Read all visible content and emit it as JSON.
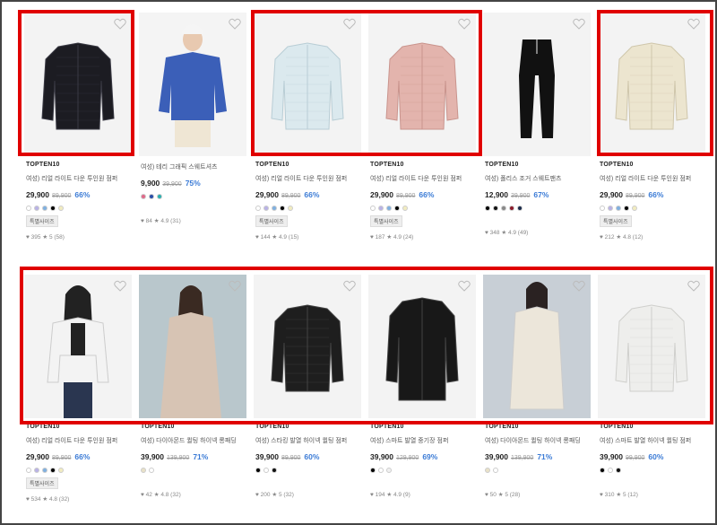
{
  "colors": {
    "highlight": "#e00000",
    "discount": "#3b7bd6"
  },
  "row1": [
    {
      "brand": "TOPTEN10",
      "name": "여성) 리얼 라이트 다운 투인원 점퍼",
      "price": "29,900",
      "orig": "89,900",
      "disc": "66%",
      "swatches": [
        "#ffffff",
        "#b9b2e6",
        "#7fb0e0",
        "#000000",
        "#f2ecc0"
      ],
      "badge": "특별사이즈",
      "stats": "♥ 395  ★ 5 (58)",
      "image": "black-quilted-jacket"
    },
    {
      "brand": "",
      "name": "여성) 테리 그래픽 스웨트셔츠",
      "price": "9,900",
      "orig": "39,900",
      "disc": "75%",
      "swatches": [
        "#e06a8a",
        "#2a4ea8",
        "#2ab0b0"
      ],
      "badge": "",
      "stats": "♥ 84  ★ 4.9 (31)",
      "image": "blue-sweatshirt-model"
    },
    {
      "brand": "TOPTEN10",
      "name": "여성) 리얼 라이트 다운 투인원 점퍼",
      "price": "29,900",
      "orig": "89,900",
      "disc": "66%",
      "swatches": [
        "#ffffff",
        "#b9b2e6",
        "#7fb0e0",
        "#000000",
        "#f2ecc0"
      ],
      "badge": "특별사이즈",
      "stats": "♥ 144  ★ 4.9 (15)",
      "image": "light-blue-jacket"
    },
    {
      "brand": "TOPTEN10",
      "name": "여성) 리얼 라이트 다운 투인원 점퍼",
      "price": "29,900",
      "orig": "89,900",
      "disc": "66%",
      "swatches": [
        "#ffffff",
        "#b9b2e6",
        "#7fb0e0",
        "#000000",
        "#f2ecc0"
      ],
      "badge": "특별사이즈",
      "stats": "♥ 187  ★ 4.9 (24)",
      "image": "pink-jacket"
    },
    {
      "brand": "TOPTEN10",
      "name": "여성) 폴리스 조거 스웨트팬츠",
      "price": "12,900",
      "orig": "39,900",
      "disc": "67%",
      "swatches": [
        "#000000",
        "#111111",
        "#888888",
        "#8b1a2a",
        "#1a2a4a"
      ],
      "badge": "",
      "stats": "♥ 348  ★ 4.9 (49)",
      "image": "black-jogger-pants"
    },
    {
      "brand": "TOPTEN10",
      "name": "여성) 리얼 라이트 다운 투인원 점퍼",
      "price": "29,900",
      "orig": "89,900",
      "disc": "66%",
      "swatches": [
        "#ffffff",
        "#b9b2e6",
        "#7fb0e0",
        "#000000",
        "#f2ecc0"
      ],
      "badge": "특별사이즈",
      "stats": "♥ 212  ★ 4.8 (12)",
      "image": "cream-jacket"
    }
  ],
  "row2": [
    {
      "brand": "TOPTEN10",
      "name": "여성) 리얼 라이트 다운 투인원 점퍼",
      "price": "29,900",
      "orig": "89,900",
      "disc": "66%",
      "swatches": [
        "#ffffff",
        "#b9b2e6",
        "#7fb0e0",
        "#000000",
        "#f2ecc0"
      ],
      "badge": "특별사이즈",
      "stats": "♥ 534  ★ 4.8 (32)",
      "image": "white-jacket-model"
    },
    {
      "brand": "TOPTEN10",
      "name": "여성) 다이아몬드 퀼팅 하이넥 롱패딩",
      "price": "39,900",
      "orig": "139,900",
      "disc": "71%",
      "swatches": [
        "#e9e2c8",
        "#ffffff"
      ],
      "badge": "",
      "stats": "♥ 42  ★ 4.8 (32)",
      "image": "beige-long-padding-model"
    },
    {
      "brand": "TOPTEN10",
      "name": "여성) 스타킹 발열 하이넥 퀼팅 점퍼",
      "price": "39,900",
      "orig": "89,900",
      "disc": "60%",
      "swatches": [
        "#000000",
        "#ffffff",
        "#111111"
      ],
      "badge": "",
      "stats": "♥ 200  ★ 5 (32)",
      "image": "black-highneck-jacket"
    },
    {
      "brand": "TOPTEN10",
      "name": "여성) 스마트 발열 중기장 점퍼",
      "price": "39,900",
      "orig": "129,900",
      "disc": "69%",
      "swatches": [
        "#000000",
        "#ffffff",
        "#f0f0f0"
      ],
      "badge": "",
      "stats": "♥ 194  ★ 4.9 (9)",
      "image": "black-mid-long-jacket"
    },
    {
      "brand": "TOPTEN10",
      "name": "여성) 다이아몬드 퀼팅 하이넥 롱패딩",
      "price": "39,900",
      "orig": "139,900",
      "disc": "71%",
      "swatches": [
        "#e9e2c8",
        "#ffffff"
      ],
      "badge": "",
      "stats": "♥ 50  ★ 5 (28)",
      "image": "cream-long-padding-model"
    },
    {
      "brand": "TOPTEN10",
      "name": "여성) 스마트 발열 하이넥 퀼팅 점퍼",
      "price": "39,900",
      "orig": "99,900",
      "disc": "60%",
      "swatches": [
        "#000000",
        "#ffffff",
        "#111111"
      ],
      "badge": "",
      "stats": "♥ 310  ★ 5 (12)",
      "image": "white-highneck-jacket"
    }
  ]
}
